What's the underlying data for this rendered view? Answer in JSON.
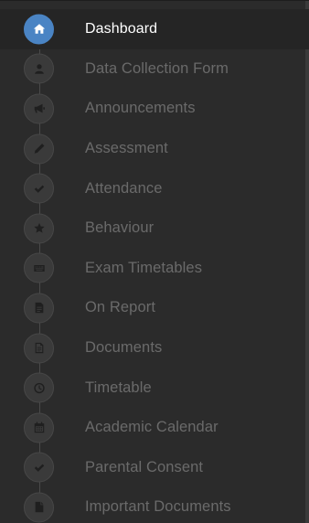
{
  "sidebar": {
    "active_color": "#4a84c4",
    "items": [
      {
        "label": "Dashboard",
        "icon": "home-icon",
        "active": true
      },
      {
        "label": "Data Collection Form",
        "icon": "user-icon",
        "active": false
      },
      {
        "label": "Announcements",
        "icon": "bullhorn-icon",
        "active": false
      },
      {
        "label": "Assessment",
        "icon": "pencil-icon",
        "active": false
      },
      {
        "label": "Attendance",
        "icon": "checkmark-icon",
        "active": false
      },
      {
        "label": "Behaviour",
        "icon": "star-icon",
        "active": false
      },
      {
        "label": "Exam Timetables",
        "icon": "keyboard-icon",
        "active": false
      },
      {
        "label": "On Report",
        "icon": "report-file-icon",
        "active": false
      },
      {
        "label": "Documents",
        "icon": "document-icon",
        "active": false
      },
      {
        "label": "Timetable",
        "icon": "clock-icon",
        "active": false
      },
      {
        "label": "Academic Calendar",
        "icon": "calendar-icon",
        "active": false
      },
      {
        "label": "Parental Consent",
        "icon": "checkmark-icon",
        "active": false
      },
      {
        "label": "Important Documents",
        "icon": "file-icon",
        "active": false
      }
    ]
  }
}
